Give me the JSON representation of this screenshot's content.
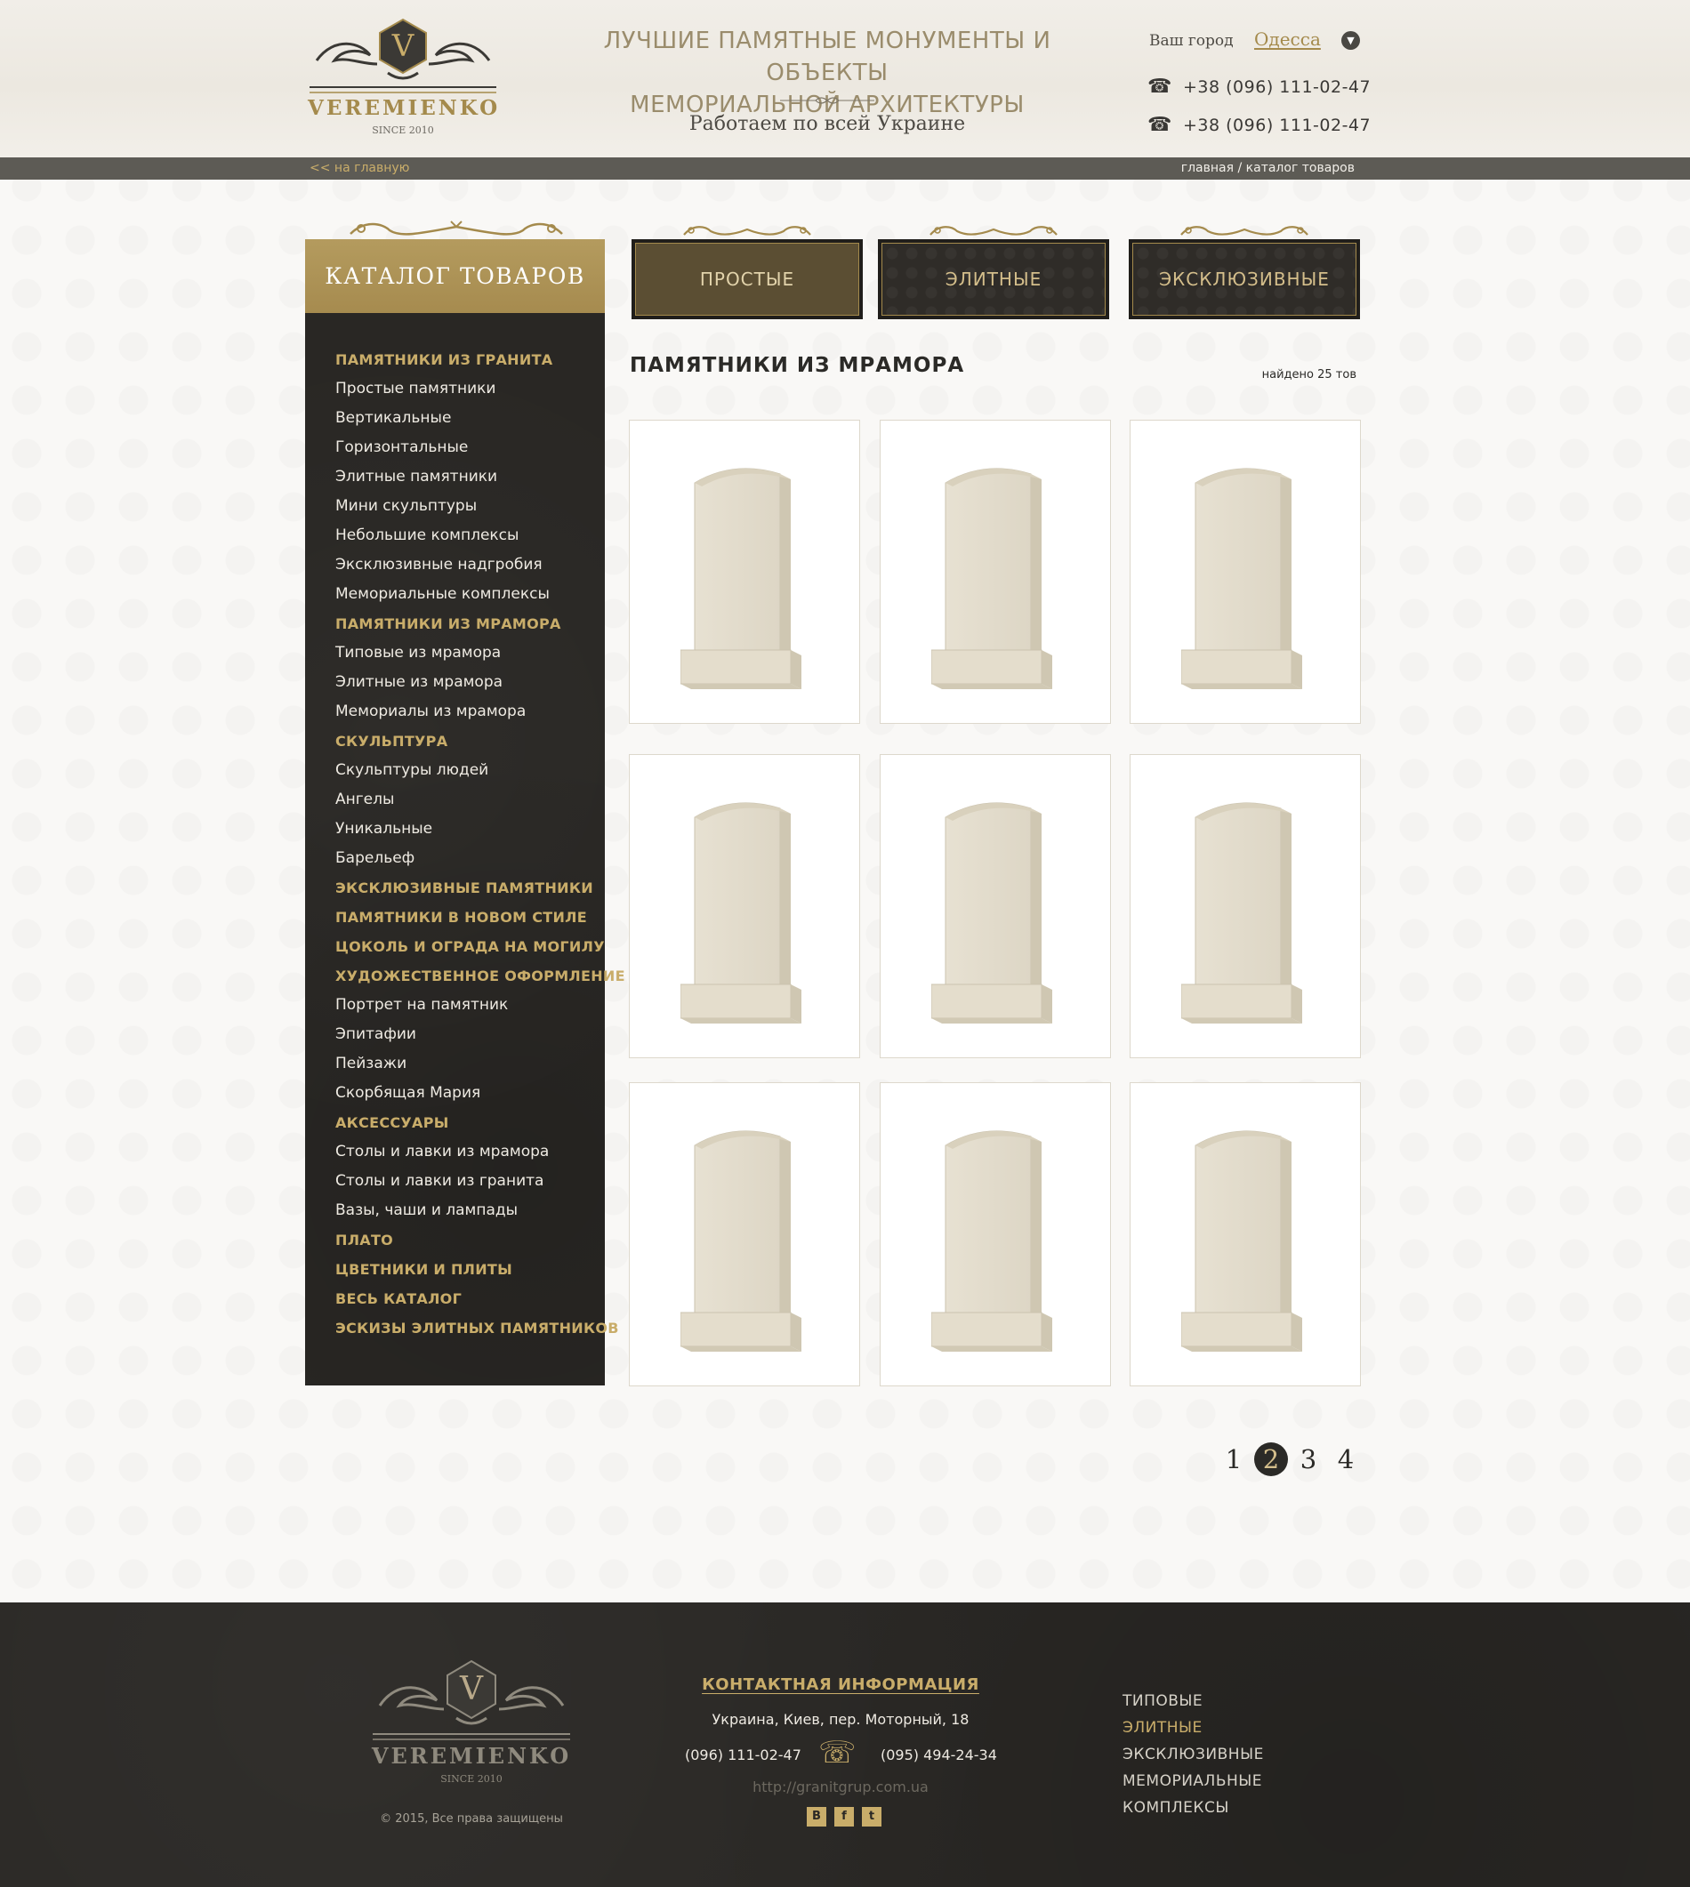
{
  "header": {
    "logo_letter": "V",
    "logo_word": "VEREMIENKO",
    "logo_since": "SINCE 2010",
    "tagline_line1": "ЛУЧШИЕ ПАМЯТНЫЕ МОНУМЕНТЫ И ОБЪЕКТЫ",
    "tagline_line2": "МЕМОРИАЛЬНОЙ АРХИТЕКТУРЫ",
    "subtagline": "Работаем по всей Украине",
    "city_label": "Ваш город",
    "city_value": "Одесса",
    "phones": [
      "+38 (096) 111-02-47",
      "+38 (096) 111-02-47"
    ]
  },
  "breadcrumb": {
    "back": "<<  на главную",
    "path": "главная  / каталог товаров"
  },
  "sidebar": {
    "title": "КАТАЛОГ  ТОВАРОВ",
    "items": [
      {
        "label": "ПАМЯТНИКИ ИЗ ГРАНИТА",
        "type": "cat"
      },
      {
        "label": "Простые памятники",
        "type": "sub"
      },
      {
        "label": "Вертикальные",
        "type": "sub"
      },
      {
        "label": "Горизонтальные",
        "type": "sub"
      },
      {
        "label": "Элитные памятники",
        "type": "sub"
      },
      {
        "label": "Мини скульптуры",
        "type": "sub"
      },
      {
        "label": "Небольшие комплексы",
        "type": "sub"
      },
      {
        "label": "Эксклюзивные надгробия",
        "type": "sub"
      },
      {
        "label": "Мемориальные комплексы",
        "type": "sub"
      },
      {
        "label": "ПАМЯТНИКИ ИЗ МРАМОРА",
        "type": "cat"
      },
      {
        "label": "Типовые из мрамора",
        "type": "sub"
      },
      {
        "label": "Элитные из мрамора",
        "type": "sub"
      },
      {
        "label": "Мемориалы из мрамора",
        "type": "sub"
      },
      {
        "label": "СКУЛЬПТУРА",
        "type": "cat"
      },
      {
        "label": "Скульптуры людей",
        "type": "sub"
      },
      {
        "label": "Ангелы",
        "type": "sub"
      },
      {
        "label": "Уникальные",
        "type": "sub"
      },
      {
        "label": "Барельеф",
        "type": "sub"
      },
      {
        "label": "ЭКСКЛЮЗИВНЫЕ ПАМЯТНИКИ",
        "type": "cat"
      },
      {
        "label": "ПАМЯТНИКИ В НОВОМ СТИЛЕ",
        "type": "cat"
      },
      {
        "label": "ЦОКОЛЬ И ОГРАДА НА МОГИЛУ",
        "type": "cat"
      },
      {
        "label": "ХУДОЖЕСТВЕННОЕ ОФОРМЛЕНИЕ",
        "type": "cat"
      },
      {
        "label": "Портрет на памятник",
        "type": "sub"
      },
      {
        "label": "Эпитафии",
        "type": "sub"
      },
      {
        "label": "Пейзажи",
        "type": "sub"
      },
      {
        "label": "Скорбящая Мария",
        "type": "sub"
      },
      {
        "label": "АКСЕССУАРЫ",
        "type": "cat"
      },
      {
        "label": "Столы и лавки из мрамора",
        "type": "sub"
      },
      {
        "label": "Столы и лавки из гранита",
        "type": "sub"
      },
      {
        "label": "Вазы, чаши и лампады",
        "type": "sub"
      },
      {
        "label": "ПЛАТО",
        "type": "cat"
      },
      {
        "label": "ЦВЕТНИКИ И ПЛИТЫ",
        "type": "cat"
      },
      {
        "label": "ВЕСЬ КАТАЛОГ",
        "type": "cat"
      },
      {
        "label": "ЭСКИЗЫ ЭЛИТНЫХ ПАМЯТНИКОВ",
        "type": "cat"
      }
    ]
  },
  "tabs": [
    {
      "label": "ПРОСТЫЕ",
      "active": true
    },
    {
      "label": "ЭЛИТНЫЕ",
      "active": false
    },
    {
      "label": "ЭКСКЛЮЗИВНЫЕ",
      "active": false
    }
  ],
  "content": {
    "title": "ПАМЯТНИКИ ИЗ МРАМОРА",
    "found": "найдено 25 тов",
    "product_count": 9
  },
  "pagination": {
    "pages": [
      "1",
      "2",
      "3",
      "4"
    ],
    "current": "2"
  },
  "footer": {
    "logo_letter": "V",
    "logo_word": "VEREMIENKO",
    "logo_since": "SINCE 2010",
    "copyright": "© 2015, Все права защищены",
    "contact_title": "КОНТАКТНАЯ ИНФОРМАЦИЯ",
    "address": "Украина, Киев, пер. Моторный, 18",
    "phone1": "(096) 111-02-47",
    "phone2": "(095) 494-24-34",
    "site": "http://granitgrup.com.ua",
    "social": [
      "В",
      "f",
      "t"
    ],
    "links": [
      {
        "label": "ТИПОВЫЕ",
        "highlight": false
      },
      {
        "label": "ЭЛИТНЫЕ",
        "highlight": true
      },
      {
        "label": "ЭКСКЛЮЗИВНЫЕ",
        "highlight": false
      },
      {
        "label": "МЕМОРИАЛЬНЫЕ",
        "highlight": false
      },
      {
        "label": "КОМПЛЕКСЫ",
        "highlight": false
      }
    ]
  },
  "colors": {
    "gold": "#a48a4c",
    "gold_light": "#c9ad6a",
    "dark": "#292724",
    "bar": "#5d5b55"
  }
}
